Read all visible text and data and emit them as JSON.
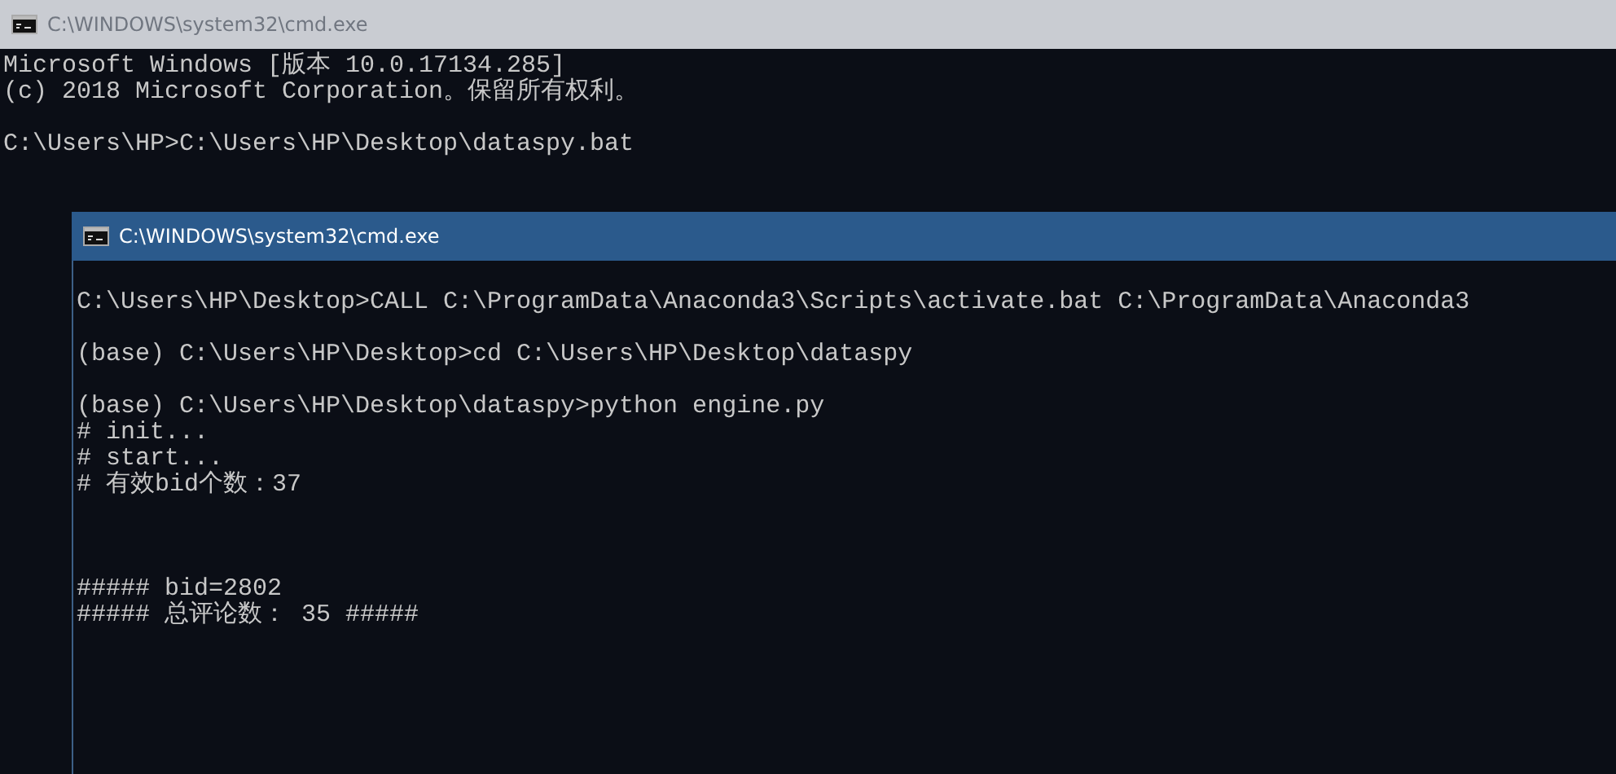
{
  "windows": [
    {
      "title": "C:\\WINDOWS\\system32\\cmd.exe",
      "active": false,
      "lines": [
        {
          "kind": "text",
          "text": "Microsoft Windows [版本 10.0.17134.285]"
        },
        {
          "kind": "text",
          "text": "(c) 2018 Microsoft Corporation。保留所有权利。"
        },
        {
          "kind": "blank"
        },
        {
          "kind": "text",
          "text": "C:\\Users\\HP>C:\\Users\\HP\\Desktop\\dataspy.bat"
        }
      ]
    },
    {
      "title": "C:\\WINDOWS\\system32\\cmd.exe",
      "active": true,
      "lines": [
        {
          "kind": "blank"
        },
        {
          "kind": "text",
          "text": "C:\\Users\\HP\\Desktop>CALL C:\\ProgramData\\Anaconda3\\Scripts\\activate.bat C:\\ProgramData\\Anaconda3"
        },
        {
          "kind": "blank"
        },
        {
          "kind": "text",
          "text": "(base) C:\\Users\\HP\\Desktop>cd C:\\Users\\HP\\Desktop\\dataspy"
        },
        {
          "kind": "blank"
        },
        {
          "kind": "text",
          "text": "(base) C:\\Users\\HP\\Desktop\\dataspy>python engine.py"
        },
        {
          "kind": "text",
          "text": "# init..."
        },
        {
          "kind": "text",
          "text": "# start..."
        },
        {
          "kind": "text",
          "text": "# 有效bid个数：37"
        },
        {
          "kind": "blank"
        },
        {
          "kind": "blank"
        },
        {
          "kind": "blank"
        },
        {
          "kind": "text",
          "text": "##### bid=2802"
        },
        {
          "kind": "text",
          "text": "##### 总评论数： 35 #####"
        }
      ]
    }
  ]
}
